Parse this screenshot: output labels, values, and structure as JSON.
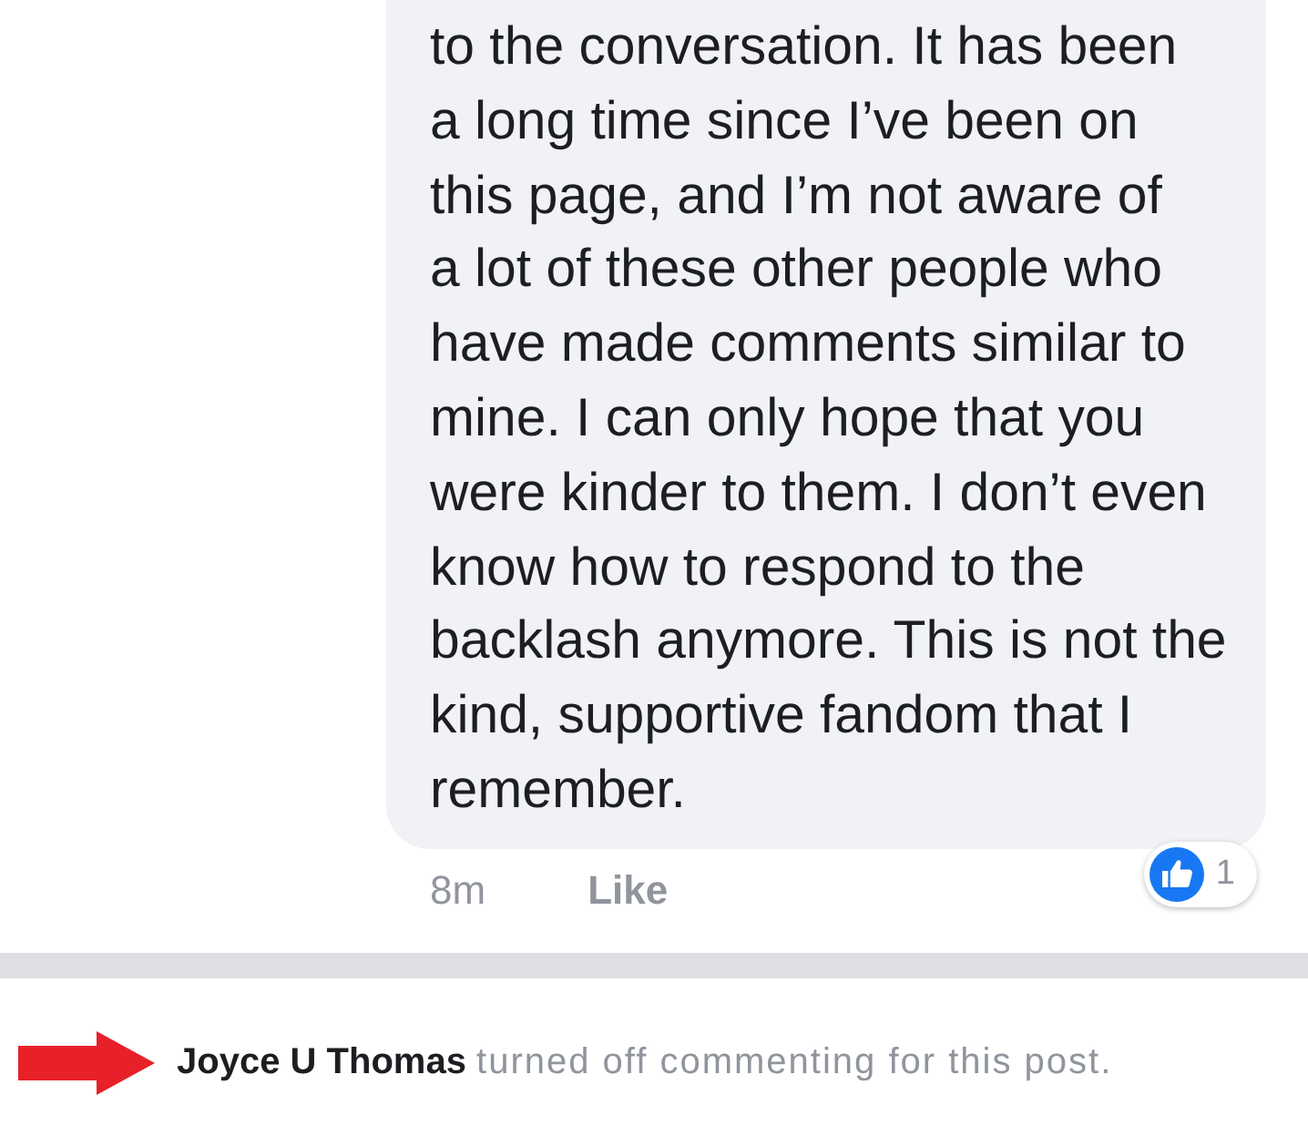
{
  "comment": {
    "lines": [
      "to the conversation. It has been",
      "a long time since I’ve been on",
      "this page, and I’m not aware of",
      "a lot of these other people who",
      "have made comments similar to",
      "mine. I can only hope that you",
      "were kinder to them. I don’t even",
      "know how to respond to the",
      "backlash anymore. This is not the",
      "kind, supportive fandom that I",
      "remember."
    ],
    "time": "8m",
    "like_label": "Like",
    "liked": false,
    "reactions": {
      "count": "1"
    }
  },
  "notice": {
    "name": "Joyce U Thomas",
    "text": "turned off commenting for this post."
  }
}
